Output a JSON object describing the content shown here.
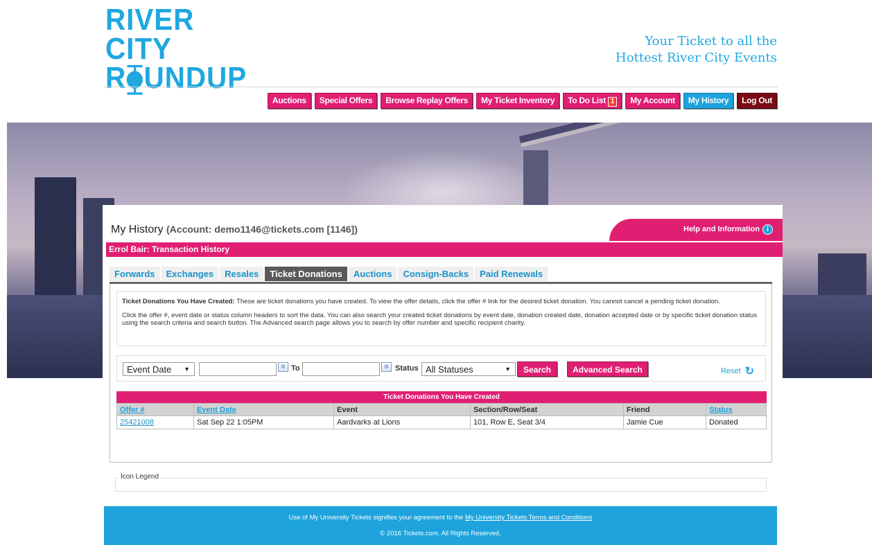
{
  "brand": {
    "line1": "RIVER CITY",
    "line2": "R⧳UNDUP",
    "tagline1": "Your Ticket to all the",
    "tagline2": "Hottest River City Events"
  },
  "nav": [
    {
      "label": "Auctions"
    },
    {
      "label": "Special Offers"
    },
    {
      "label": "Browse Replay Offers"
    },
    {
      "label": "My Ticket Inventory"
    },
    {
      "label": "To Do List",
      "badge": "1"
    },
    {
      "label": "My Account"
    },
    {
      "label": "My History"
    },
    {
      "label": "Log Out"
    }
  ],
  "page": {
    "title": "My History",
    "account": "(Account: demo1146@tickets.com [1146])",
    "help": "Help and Information",
    "subheader": "Errol Bair: Transaction History"
  },
  "tabs": [
    {
      "label": "Forwards"
    },
    {
      "label": "Exchanges"
    },
    {
      "label": "Resales"
    },
    {
      "label": "Ticket Donations"
    },
    {
      "label": "Auctions"
    },
    {
      "label": "Consign-Backs"
    },
    {
      "label": "Paid Renewals"
    }
  ],
  "description": {
    "bold": "Ticket Donations You Have Created:",
    "p1": " These are ticket donations you have created. To view the offer details, click the offer # link for the desired ticket donation. You cannot cancel a pending ticket donation.",
    "p2": "Click the offer #, event date or status column headers to sort the data. You can also search your created ticket donations by event date, donation created date, donation accepted date or by specific ticket donation status using the search criteria and search button. The Advanced search page allows you to search by offer number and specific recipient charity."
  },
  "search": {
    "date_type": "Event Date",
    "from_value": "",
    "to_label": "To",
    "to_value": "",
    "status_label": "Status",
    "status_value": "All Statuses",
    "search_btn": "Search",
    "advanced_btn": "Advanced Search",
    "reset": "Reset"
  },
  "table": {
    "title": "Ticket Donations You Have Created",
    "headers": [
      "Offer #",
      "Event Date",
      "Event",
      "Section/Row/Seat",
      "Friend",
      "Status"
    ],
    "rows": [
      [
        "25421008",
        "Sat Sep 22 1:05PM",
        "Aardvarks at Lions",
        "101, Row E, Seat 3/4",
        "Jamie Cue",
        "Donated"
      ]
    ]
  },
  "legend": {
    "label": "Icon Legend"
  },
  "footer": {
    "line1_prefix": "Use of My University Tickets signifies your agreement to the ",
    "line1_link": "My University Tickets Terms and Conditions",
    "line2": "© 2016 Tickets.com. All Rights Reserved."
  },
  "colors": {
    "brand_pink": "#e01f73",
    "brand_blue": "#1ea3dc",
    "logout_red": "#7a0b14"
  }
}
